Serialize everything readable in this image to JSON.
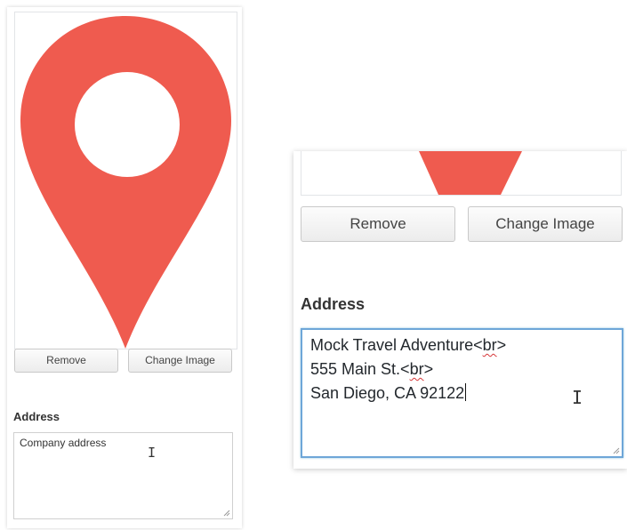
{
  "colors": {
    "pin": "#ef5b4f",
    "focus_border": "#6ea6d8",
    "panel_border": "#e2e4e7"
  },
  "left_panel": {
    "image_icon": "map-pin-icon",
    "remove_label": "Remove",
    "change_image_label": "Change Image",
    "address_label": "Address",
    "address_value": "Company address"
  },
  "right_panel": {
    "remove_label": "Remove",
    "change_image_label": "Change Image",
    "address_label": "Address",
    "address_lines": [
      {
        "text": "Mock Travel Adventure<",
        "flagged": "br",
        "tail": ">"
      },
      {
        "text": "555 Main St.<",
        "flagged": "br",
        "tail": ">"
      },
      {
        "text": "San Diego, CA 92122",
        "flagged": "",
        "tail": ""
      }
    ]
  }
}
